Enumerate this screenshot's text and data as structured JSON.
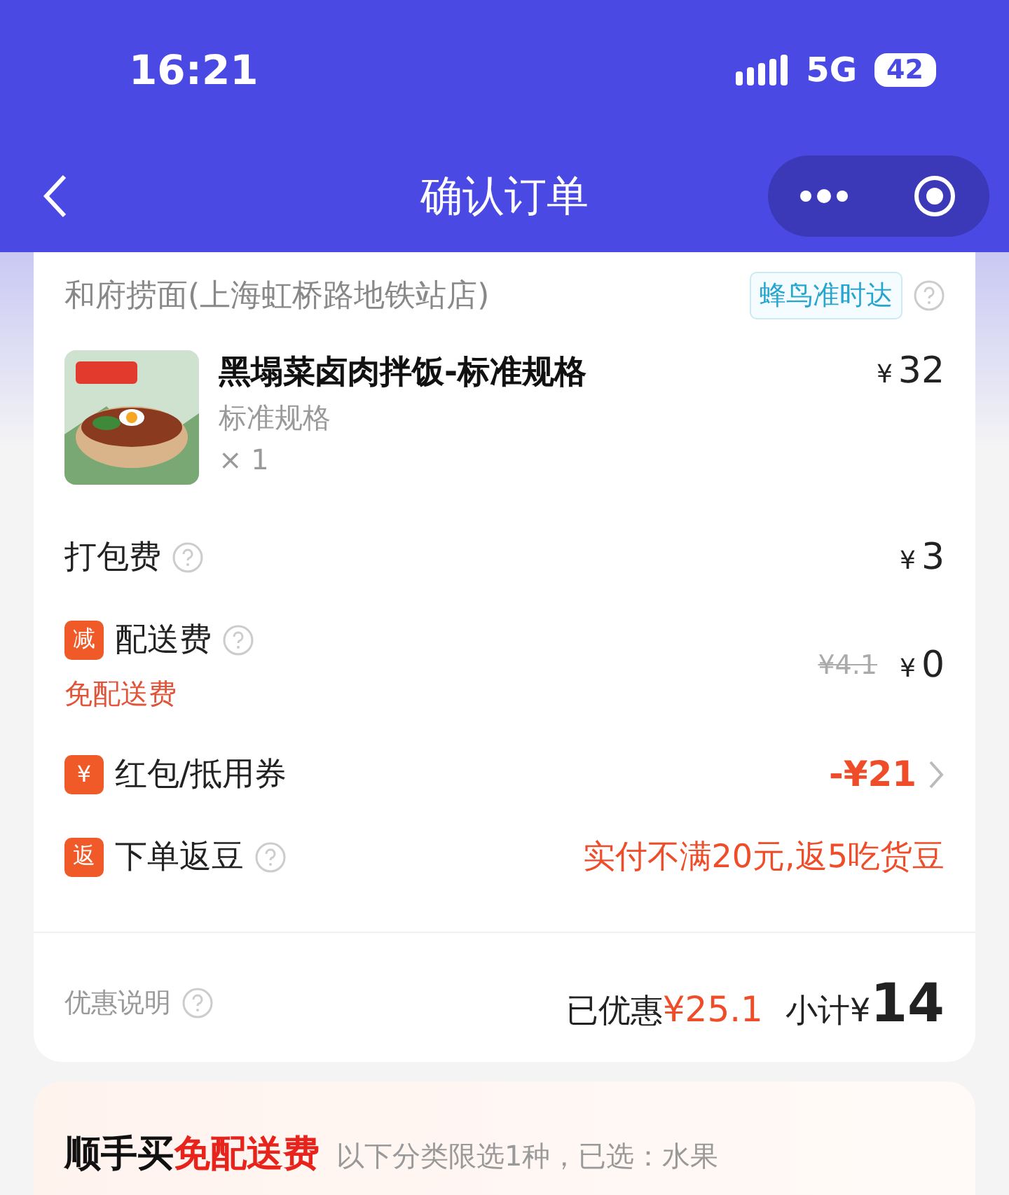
{
  "status_bar": {
    "time": "16:21",
    "network": "5G",
    "battery": "42"
  },
  "nav": {
    "title": "确认订单"
  },
  "store": {
    "name": "和府捞面(上海虹桥路地铁站店)",
    "delivery_tag": "蜂鸟准时达"
  },
  "item": {
    "kind": "picture",
    "name": "黑塌菜卤肉拌饭-标准规格",
    "spec": "标准规格",
    "quantity": "× 1",
    "currency": "¥",
    "price": "32"
  },
  "fees": [
    {
      "kind": "plain",
      "label": "打包费",
      "currency": "¥",
      "value": "3"
    },
    {
      "kind": "discount",
      "badge": "减",
      "label": "配送费",
      "note": "免配送费",
      "original": "¥4.1",
      "currency": "¥",
      "value": "0"
    },
    {
      "kind": "coupon",
      "badge": "¥",
      "label": "红包/抵用券",
      "value": "-¥21"
    },
    {
      "kind": "rebate",
      "badge": "返",
      "label": "下单返豆",
      "value": "实付不满20元,返5吃货豆"
    }
  ],
  "summary": {
    "label": "优惠说明",
    "saved_label": "已优惠",
    "saved_amount": "¥25.1",
    "subtotal_label": "小计¥",
    "subtotal": "14"
  },
  "promo": {
    "title": "顺手买",
    "highlight": "免配送费",
    "note": "以下分类限选1种，已选：水果"
  }
}
